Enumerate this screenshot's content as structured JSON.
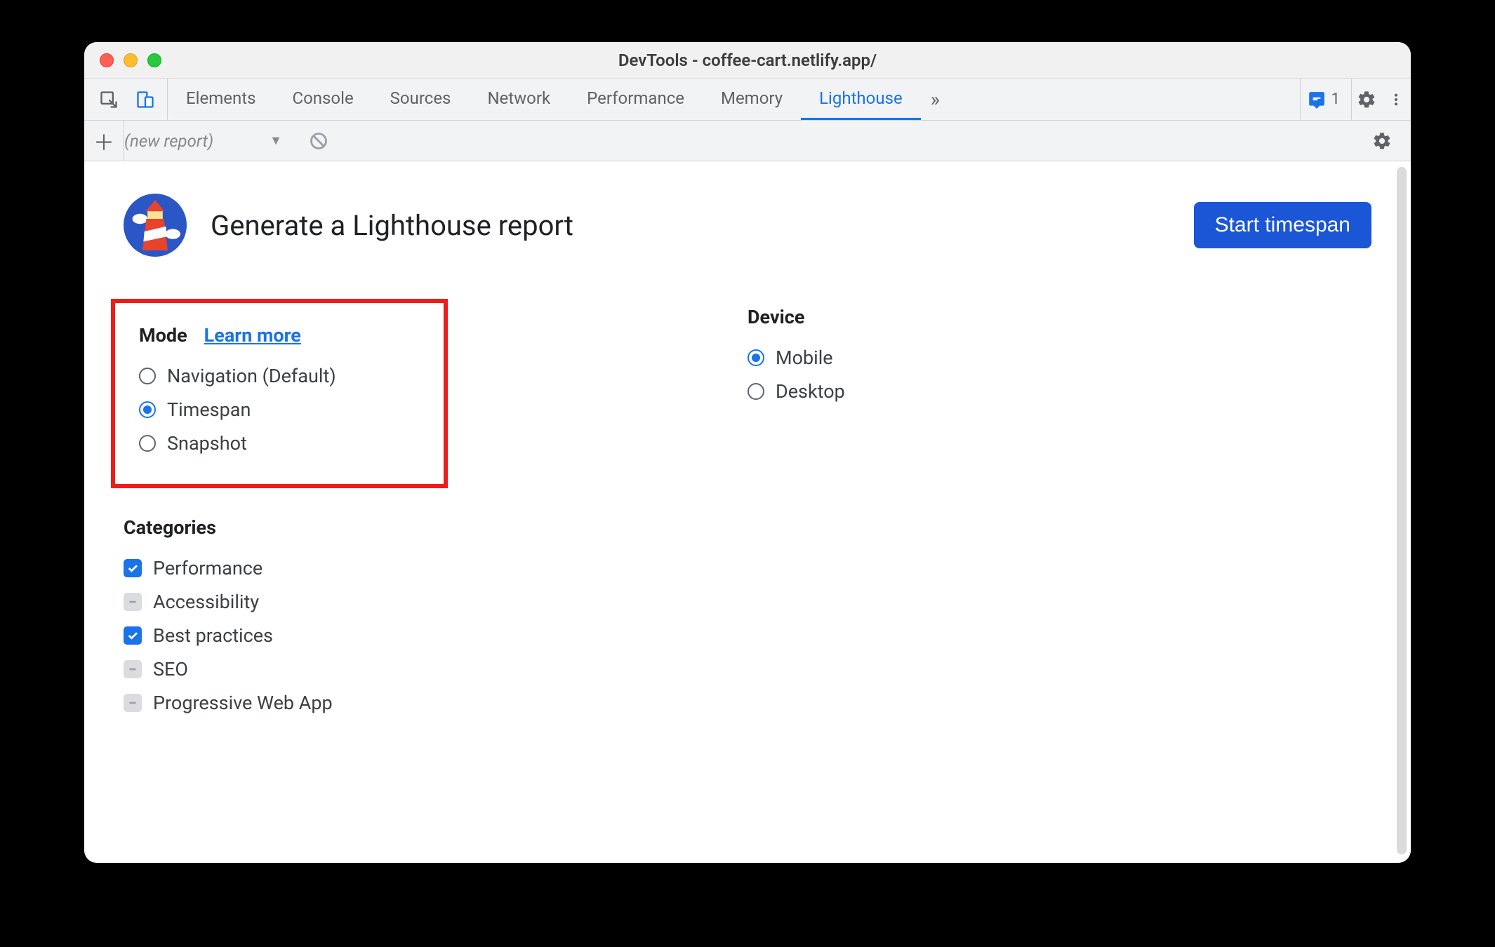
{
  "window": {
    "title": "DevTools - coffee-cart.netlify.app/"
  },
  "tabs": {
    "items": [
      "Elements",
      "Console",
      "Sources",
      "Network",
      "Performance",
      "Memory",
      "Lighthouse"
    ],
    "active": "Lighthouse",
    "issues_count": "1"
  },
  "toolbar": {
    "report_label": "(new report)"
  },
  "header": {
    "title": "Generate a Lighthouse report",
    "start_label": "Start timespan"
  },
  "mode": {
    "label": "Mode",
    "learn_more": "Learn more",
    "options": [
      {
        "label": "Navigation (Default)",
        "checked": false
      },
      {
        "label": "Timespan",
        "checked": true
      },
      {
        "label": "Snapshot",
        "checked": false
      }
    ]
  },
  "device": {
    "label": "Device",
    "options": [
      {
        "label": "Mobile",
        "checked": true
      },
      {
        "label": "Desktop",
        "checked": false
      }
    ]
  },
  "categories": {
    "label": "Categories",
    "items": [
      {
        "label": "Performance",
        "state": "checked"
      },
      {
        "label": "Accessibility",
        "state": "indeterminate"
      },
      {
        "label": "Best practices",
        "state": "checked"
      },
      {
        "label": "SEO",
        "state": "indeterminate"
      },
      {
        "label": "Progressive Web App",
        "state": "indeterminate"
      }
    ]
  },
  "colors": {
    "accent": "#1a73e8",
    "highlight": "#ef1c1c",
    "primary_btn": "#1a56d6"
  }
}
